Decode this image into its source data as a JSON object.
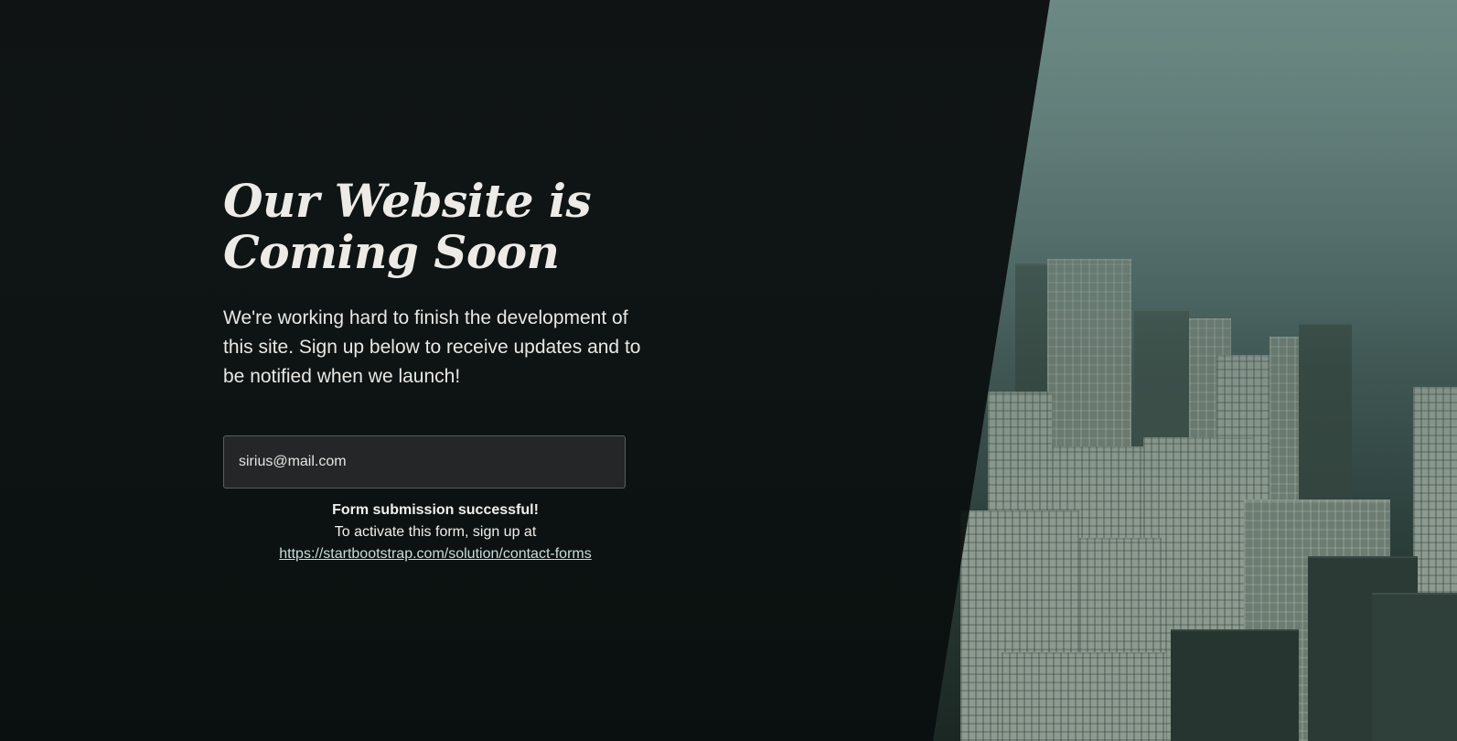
{
  "hero": {
    "headline": "Our Website is\nComing Soon",
    "lead": "We're working hard to finish the development of this site. Sign up below to receive updates and to be notified when we launch!"
  },
  "form": {
    "email_value": "sirius@mail.com",
    "success_title": "Form submission successful!",
    "success_note": "To activate this form, sign up at",
    "success_link": "https://startbootstrap.com/solution/contact-forms"
  },
  "colors": {
    "overlay": "#0b0f10",
    "input_bg": "#242627",
    "link": "#c9ddda"
  }
}
